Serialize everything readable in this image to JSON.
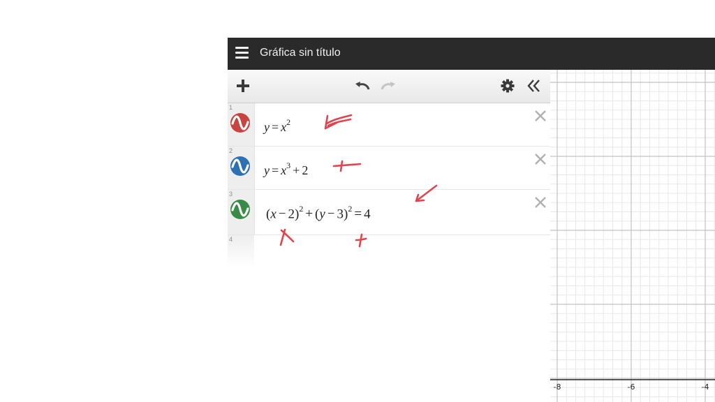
{
  "app": {
    "title": "Gráfica sin título"
  },
  "toolbar": {
    "add_icon": "plus-icon",
    "undo_icon": "undo-icon",
    "redo_icon": "redo-icon",
    "settings_icon": "gear-icon",
    "collapse_icon": "double-chevron-left-icon"
  },
  "expressions": [
    {
      "num": "1",
      "color": "#c74440",
      "latex": "y=x^2"
    },
    {
      "num": "2",
      "color": "#2d70b3",
      "latex": "y=x^3+2"
    },
    {
      "num": "3",
      "color": "#388c46",
      "latex": "(x-2)^2+(y-3)^2=4"
    },
    {
      "num": "4",
      "color": "",
      "latex": ""
    }
  ],
  "expr1": {
    "y": "y",
    "eq": "=",
    "x": "x",
    "exp": "2"
  },
  "expr2": {
    "y": "y",
    "eq": "=",
    "x": "x",
    "exp": "3",
    "plus": "+",
    "c": "2"
  },
  "expr3": {
    "lp1": "(",
    "x": "x",
    "m1": "−",
    "a": "2",
    "rp1": ")",
    "e1": "2",
    "plus": "+",
    "lp2": "(",
    "y": "y",
    "m2": "−",
    "b": "3",
    "rp2": ")",
    "e2": "2",
    "eq": "=",
    "r": "4"
  },
  "graph": {
    "x_tick_labels": [
      "-8",
      "-6",
      "-4"
    ],
    "grid": true
  },
  "colors": {
    "topbar": "#2a2a2a",
    "annotation_ink": "#e0454f"
  }
}
